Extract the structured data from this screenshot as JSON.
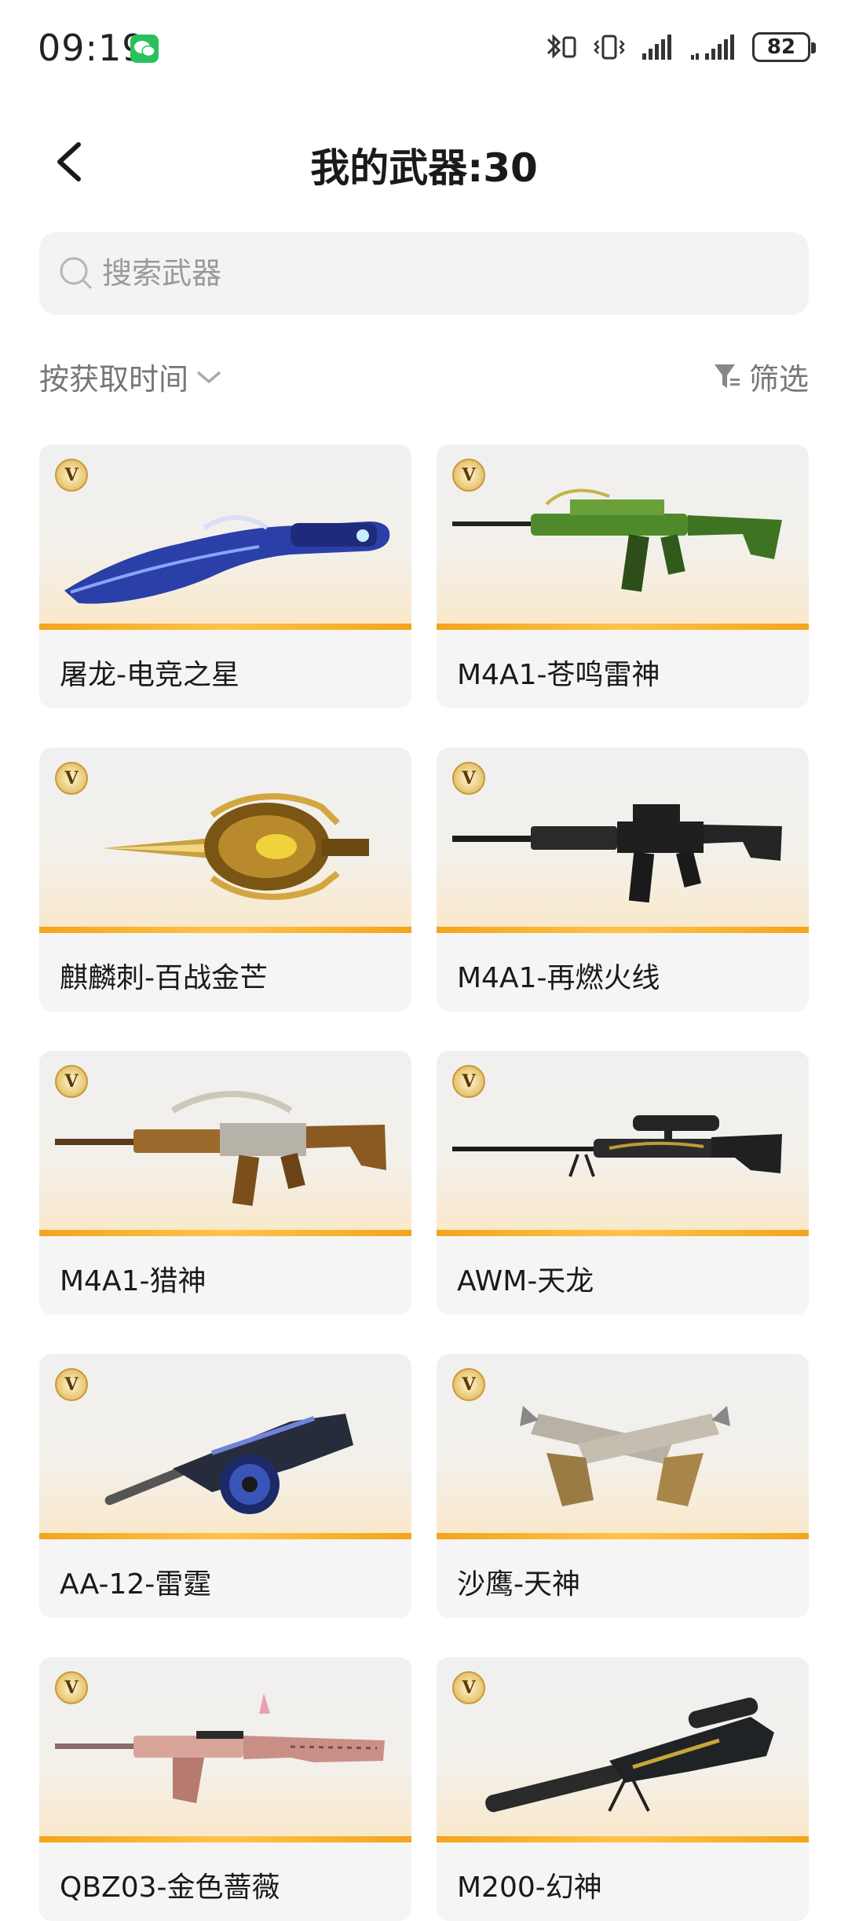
{
  "status_bar": {
    "time": "09:19",
    "battery": "82"
  },
  "header": {
    "title": "我的武器:30"
  },
  "search": {
    "placeholder": "搜索武器"
  },
  "sort": {
    "label": "按获取时间"
  },
  "filter": {
    "label": "筛选"
  },
  "badge_letter": "V",
  "colors": {
    "accent": "#f3a51b",
    "badge_gold": "#e7c36c",
    "card_bg": "#f5f5f5",
    "search_bg": "#f3f3f3"
  },
  "weapons": [
    {
      "name": "屠龙-电竞之星",
      "icon": "kukri-knife-icon"
    },
    {
      "name": "M4A1-苍鸣雷神",
      "icon": "assault-rifle-icon"
    },
    {
      "name": "麒麟刺-百战金芒",
      "icon": "golden-blade-icon"
    },
    {
      "name": "M4A1-再燃火线",
      "icon": "assault-rifle-icon"
    },
    {
      "name": "M4A1-猎神",
      "icon": "assault-rifle-icon"
    },
    {
      "name": "AWM-天龙",
      "icon": "sniper-rifle-icon"
    },
    {
      "name": "AA-12-雷霆",
      "icon": "drum-shotgun-icon"
    },
    {
      "name": "沙鹰-天神",
      "icon": "dual-pistols-icon"
    },
    {
      "name": "QBZ03-金色蔷薇",
      "icon": "assault-rifle-icon"
    },
    {
      "name": "M200-幻神",
      "icon": "sniper-rifle-icon"
    }
  ]
}
